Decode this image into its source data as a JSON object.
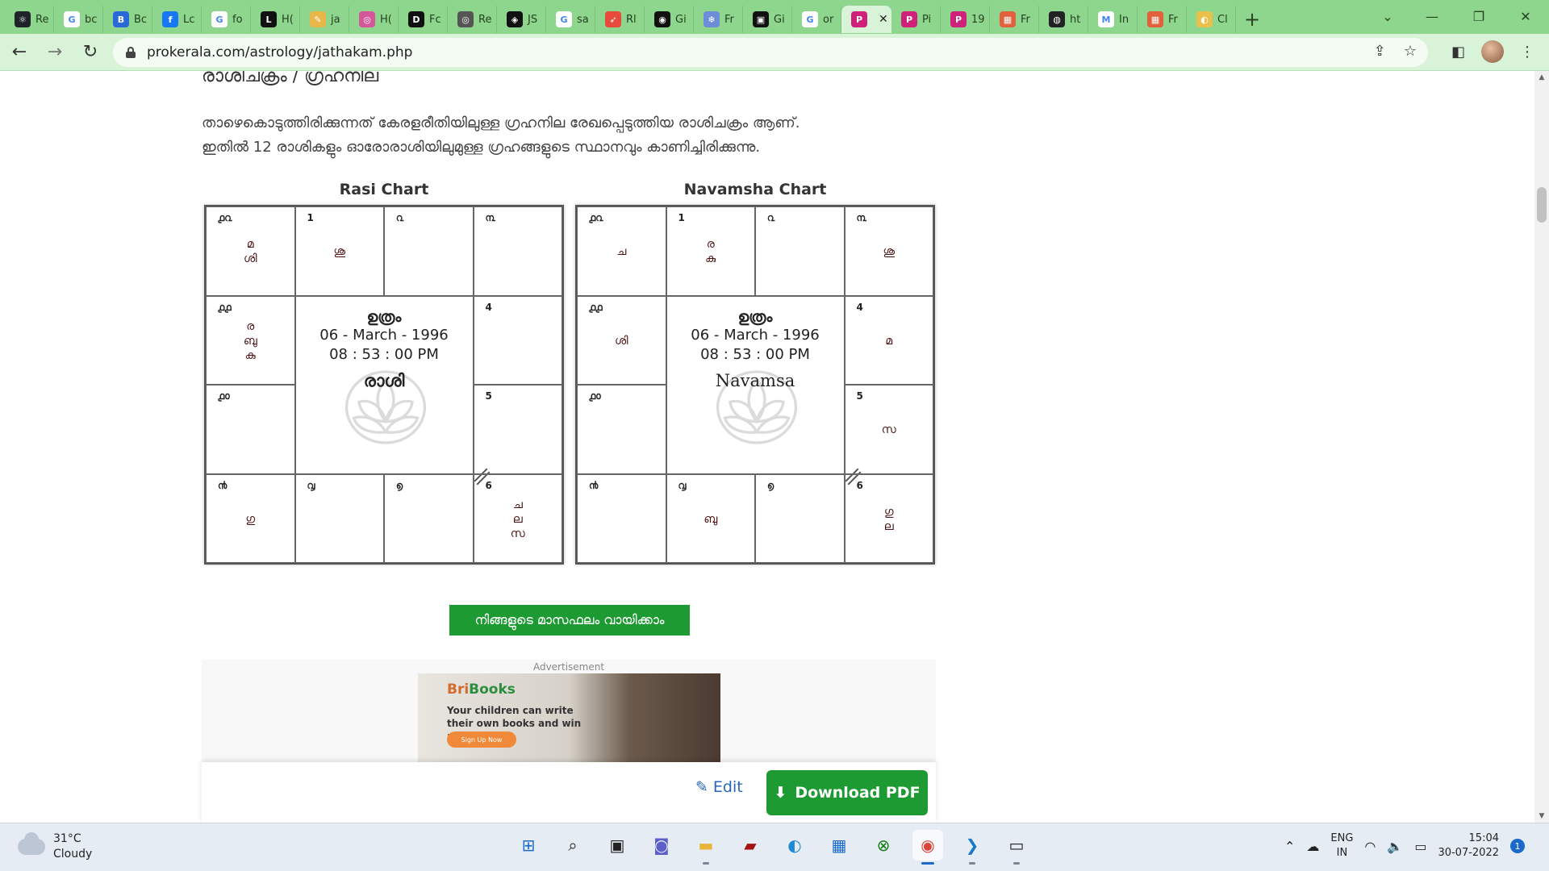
{
  "browser": {
    "tabs": [
      {
        "label": "Re",
        "icon": "react-icon",
        "color": "#20232a",
        "glyph": "⚛"
      },
      {
        "label": "bc",
        "icon": "google-icon",
        "color": "#ffffff",
        "glyph": "G"
      },
      {
        "label": "Bc",
        "icon": "bootstrap-icon",
        "color": "#2a6ad8",
        "glyph": "B"
      },
      {
        "label": "Lc",
        "icon": "facebook-icon",
        "color": "#1877f2",
        "glyph": "f"
      },
      {
        "label": "fo",
        "icon": "google-icon",
        "color": "#ffffff",
        "glyph": "G"
      },
      {
        "label": "H(",
        "icon": "l-icon",
        "color": "#111111",
        "glyph": "L"
      },
      {
        "label": "ja",
        "icon": "pen-icon",
        "color": "#e9b64a",
        "glyph": "✎"
      },
      {
        "label": "H(",
        "icon": "instagram-icon",
        "color": "#d6569a",
        "glyph": "◎"
      },
      {
        "label": "Fc",
        "icon": "dev-icon",
        "color": "#111111",
        "glyph": "D"
      },
      {
        "label": "Re",
        "icon": "circle-icon",
        "color": "#555555",
        "glyph": "◎"
      },
      {
        "label": "JS",
        "icon": "codepen-icon",
        "color": "#111111",
        "glyph": "◈"
      },
      {
        "label": "sa",
        "icon": "google-icon",
        "color": "#ffffff",
        "glyph": "G"
      },
      {
        "label": "Rl",
        "icon": "rocket-icon",
        "color": "#e84a3c",
        "glyph": "➶"
      },
      {
        "label": "Gi",
        "icon": "github-icon",
        "color": "#111111",
        "glyph": "◉"
      },
      {
        "label": "Fr",
        "icon": "snowflake-icon",
        "color": "#6c8ed8",
        "glyph": "❄"
      },
      {
        "label": "Gi",
        "icon": "book-icon",
        "color": "#111111",
        "glyph": "▣"
      },
      {
        "label": "or",
        "icon": "google-icon",
        "color": "#ffffff",
        "glyph": "G"
      },
      {
        "label": "",
        "icon": "prokerala-icon",
        "color": "#d0217a",
        "glyph": "P",
        "active": true
      },
      {
        "label": "Pi",
        "icon": "prokerala-icon",
        "color": "#d0217a",
        "glyph": "P"
      },
      {
        "label": "19",
        "icon": "prokerala-icon",
        "color": "#d0217a",
        "glyph": "P"
      },
      {
        "label": "Fr",
        "icon": "grid-icon",
        "color": "#e2603c",
        "glyph": "▦"
      },
      {
        "label": "ht",
        "icon": "globe-icon",
        "color": "#222222",
        "glyph": "◍"
      },
      {
        "label": "In",
        "icon": "gmail-icon",
        "color": "#ffffff",
        "glyph": "M"
      },
      {
        "label": "Fr",
        "icon": "grid-icon",
        "color": "#e2603c",
        "glyph": "▦"
      },
      {
        "label": "Cl",
        "icon": "chrome-icon",
        "color": "#e9c14a",
        "glyph": "◐"
      }
    ],
    "url": "prokerala.com/astrology/jathakam.php"
  },
  "page": {
    "heading": "രാശിചക്രം / ഗ്രഹനില",
    "paragraph_line1": "താഴെകൊടുത്തിരിക്കുന്നത് കേരളരീതിയിലുള്ള ഗ്രഹനില രേഖപ്പെടുത്തിയ രാശിചക്രം ആണ്.",
    "paragraph_line2": "ഇതിൽ 12 രാശികളും ഓരോരാശിയിലുമുള്ള ഗ്രഹങ്ങളുടെ സ്ഥാനവും കാണിച്ചിരിക്കുന്നു.",
    "rasi": {
      "title": "Rasi Chart",
      "center_star": "ഉത്രം",
      "center_date": "06 - March - 1996",
      "center_time": "08 : 53 : 00 PM",
      "center_label": "രാശി",
      "cells": {
        "12": {
          "num": "൧൨",
          "planets": [
            "മ",
            "ശി"
          ]
        },
        "1": {
          "num": "1",
          "planets": [
            "ശു"
          ]
        },
        "2": {
          "num": "൨",
          "planets": []
        },
        "3": {
          "num": "൩",
          "planets": []
        },
        "11": {
          "num": "൧൧",
          "planets": [
            "ര",
            "ബു",
            "കു"
          ]
        },
        "4": {
          "num": "4",
          "planets": []
        },
        "10": {
          "num": "൧൦",
          "planets": []
        },
        "5": {
          "num": "5",
          "planets": []
        },
        "9": {
          "num": "൯",
          "planets": [
            "ഗു"
          ]
        },
        "8": {
          "num": "൮",
          "planets": []
        },
        "7": {
          "num": "൭",
          "planets": []
        },
        "6": {
          "num": "6",
          "planets": [
            "ച",
            "ല",
            "സ"
          ]
        }
      }
    },
    "navamsha": {
      "title": "Navamsha Chart",
      "center_star": "ഉത്രം",
      "center_date": "06 - March - 1996",
      "center_time": "08 : 53 : 00 PM",
      "center_label": "Navamsa",
      "cells": {
        "12": {
          "num": "൧൨",
          "planets": [
            "ച"
          ]
        },
        "1": {
          "num": "1",
          "planets": [
            "ര",
            "കു"
          ]
        },
        "2": {
          "num": "൨",
          "planets": []
        },
        "3": {
          "num": "൩",
          "planets": [
            "ശു"
          ]
        },
        "11": {
          "num": "൧൧",
          "planets": [
            "ശി"
          ]
        },
        "4": {
          "num": "4",
          "planets": [
            "മ"
          ]
        },
        "10": {
          "num": "൧൦",
          "planets": []
        },
        "5": {
          "num": "5",
          "planets": [
            "സ"
          ]
        },
        "9": {
          "num": "൯",
          "planets": []
        },
        "8": {
          "num": "൮",
          "planets": [
            "ബു"
          ]
        },
        "7": {
          "num": "൭",
          "planets": []
        },
        "6": {
          "num": "6",
          "planets": [
            "ഗു",
            "ല"
          ]
        }
      }
    },
    "cta_button": "നിങ്ങളുടെ മാസഫലം വായിക്കാം",
    "ad": {
      "label": "Advertisement",
      "brand_prefix": "Bri",
      "brand_suffix": "Books",
      "tagline": "Your children can write their own books and win awards",
      "signup": "Sign Up Now"
    },
    "actions": {
      "edit": "Edit",
      "download": "Download PDF"
    }
  },
  "taskbar": {
    "weather_temp": "31°C",
    "weather_desc": "Cloudy",
    "lang_top": "ENG",
    "lang_bottom": "IN",
    "time": "15:04",
    "date": "30-07-2022",
    "notifications": "1",
    "apps": [
      "start-icon",
      "search-icon",
      "task-view-icon",
      "chat-icon",
      "file-explorer-icon",
      "photo-app-icon",
      "edge-icon",
      "store-icon",
      "xbox-icon",
      "chrome-icon",
      "vscode-icon",
      "terminal-icon"
    ]
  }
}
